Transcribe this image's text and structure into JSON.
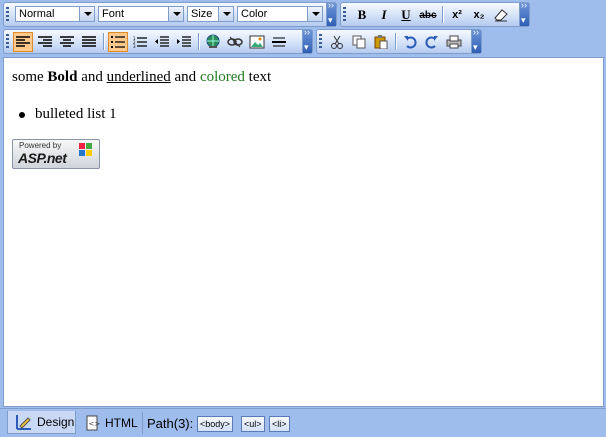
{
  "toolbar1": {
    "format_select": "Normal",
    "font_select": "Font",
    "size_select": "Size",
    "color_select": "Color",
    "bold": "B",
    "italic": "I",
    "underline": "U",
    "strike": "abc",
    "superscript": "x²",
    "subscript": "x₂"
  },
  "editor": {
    "t1": "some ",
    "t2": "Bold",
    "t3": " and ",
    "t4": "underlined",
    "t5": " and ",
    "t6": "colored",
    "t7": " text",
    "bullet": "bulleted list 1",
    "badge_top": "Powered by",
    "badge_main": "ASP.net",
    "colored_color": "#207a20"
  },
  "status": {
    "design_tab": "Design",
    "html_tab": "HTML",
    "path_label": "Path(3):",
    "tags": [
      "<body>",
      "<ul>",
      "<li>"
    ]
  }
}
